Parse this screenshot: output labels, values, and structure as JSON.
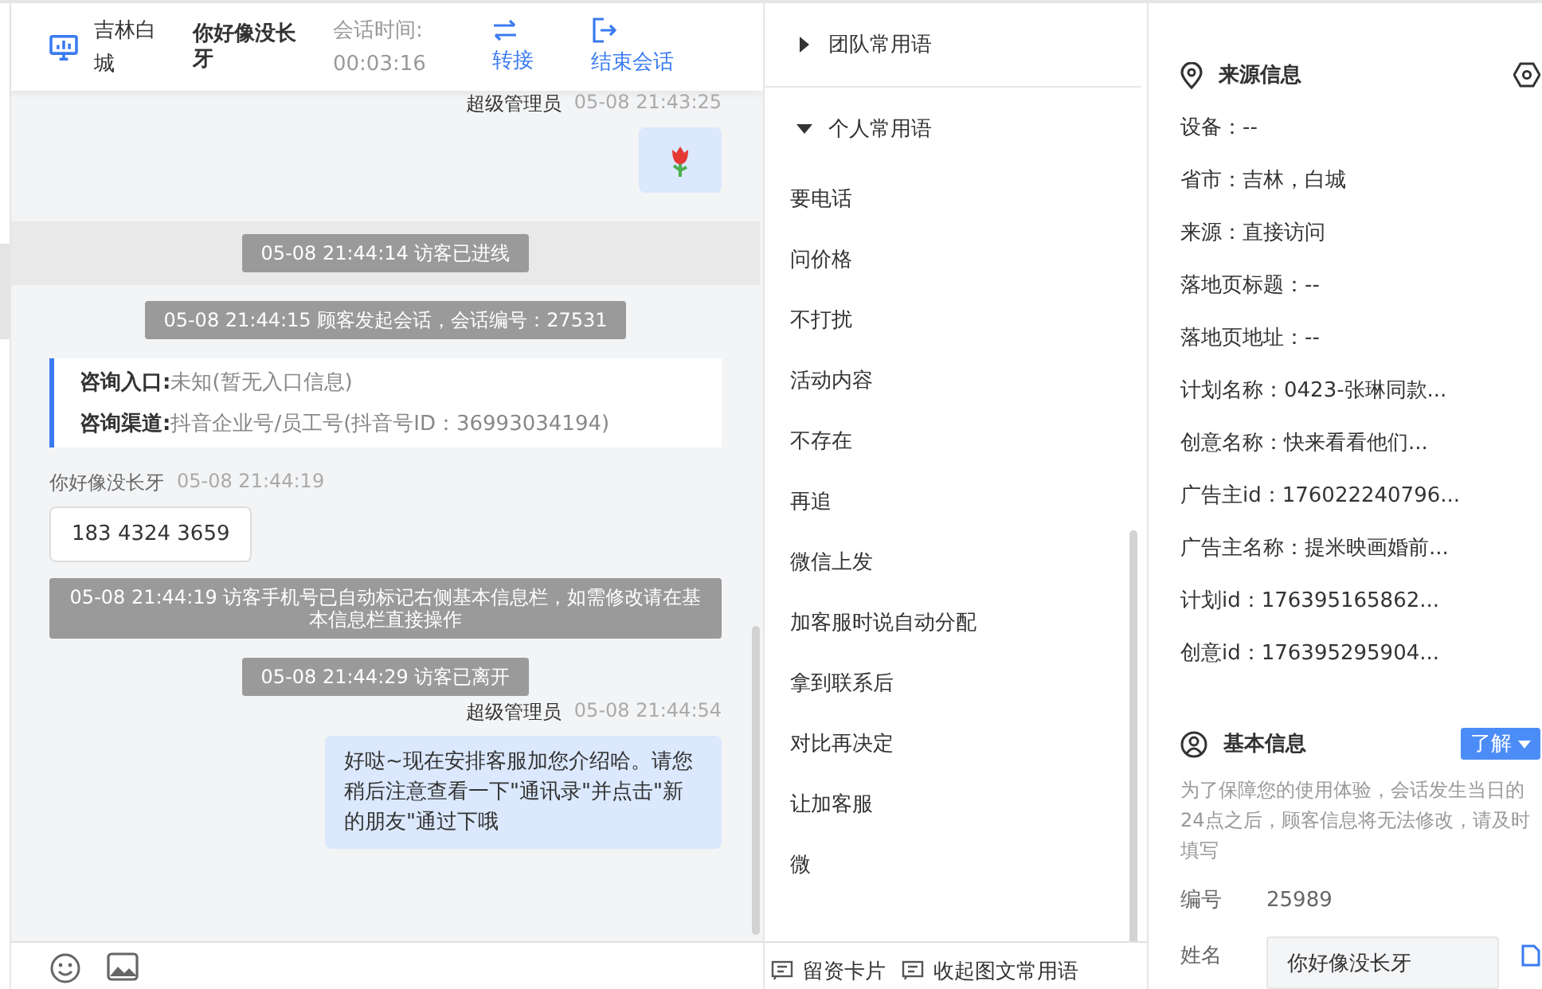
{
  "chat_header": {
    "location": "吉林白城",
    "visitor": "你好像没长牙",
    "duration_label": "会话时间:",
    "duration": "00:03:16",
    "actions": [
      {
        "kind": "transfer",
        "label": "转接"
      },
      {
        "kind": "end",
        "label": "结束会话"
      }
    ]
  },
  "messages": [
    {
      "kind": "agent_image",
      "sender": "超级管理员",
      "time": "05-08 21:43:25"
    },
    {
      "kind": "notice",
      "text": "05-08 21:44:14 访客已进线",
      "highlighted": true
    },
    {
      "kind": "notice",
      "text": "05-08 21:44:15 顾客发起会话，会话编号：27531",
      "highlighted": false
    },
    {
      "kind": "info_card",
      "rows": [
        {
          "label": "咨询入口:",
          "value": "未知(暂无入口信息)"
        },
        {
          "label": "咨询渠道:",
          "value": "抖音企业号/员工号(抖音号ID：36993034194)"
        }
      ]
    },
    {
      "kind": "visitor_text",
      "sender": "你好像没长牙",
      "time": "05-08 21:44:19",
      "text": "183 4324 3659"
    },
    {
      "kind": "notice",
      "text": "05-08 21:44:19 访客手机号已自动标记右侧基本信息栏，如需修改请在基本信息栏直接操作",
      "highlighted": false
    },
    {
      "kind": "notice",
      "text": "05-08 21:44:29 访客已离开",
      "highlighted": false
    },
    {
      "kind": "agent_text",
      "sender": "超级管理员",
      "time": "05-08 21:44:54",
      "text": "好哒~现在安排客服加您介绍哈。请您稍后注意查看一下\"通讯录\"并点击\"新的朋友\"通过下哦"
    }
  ],
  "phrases": {
    "groups": [
      {
        "label": "团队常用语",
        "expanded": false
      },
      {
        "label": "个人常用语",
        "expanded": true
      }
    ],
    "items": [
      "要电话",
      "问价格",
      "不打扰",
      "活动内容",
      "不存在",
      "再追",
      "微信上发",
      "加客服时说自动分配",
      "拿到联系后",
      "对比再决定",
      "让加客服",
      "微"
    ],
    "footer": [
      {
        "label": "留资卡片"
      },
      {
        "label": "收起图文常用语"
      }
    ]
  },
  "source_info": {
    "title": "来源信息",
    "rows": [
      "设备：--",
      "省市：吉林，白城",
      "来源：直接访问",
      "落地页标题：--",
      "落地页地址：--",
      "计划名称：0423-张琳同款...",
      "创意名称：快来看看他们...",
      "广告主id：176022240796...",
      "广告主名称：提米映画婚前...",
      "计划id：176395165862...",
      "创意id：176395295904..."
    ]
  },
  "basic_info": {
    "title": "基本信息",
    "dropdown": "了解",
    "note": "为了保障您的使用体验，会话发生当日的24点之后，顾客信息将无法修改，请及时填写",
    "fields": [
      {
        "kind": "text",
        "label": "编号",
        "value": "25989"
      },
      {
        "kind": "input",
        "label": "姓名",
        "value": "你好像没长牙"
      }
    ]
  }
}
